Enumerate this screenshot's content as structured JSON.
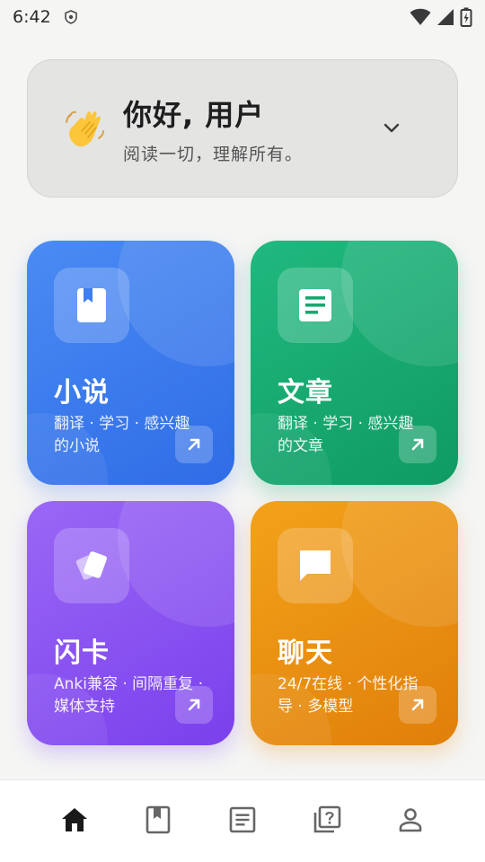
{
  "status_bar": {
    "time": "6:42"
  },
  "greeting": {
    "title": "你好, 用户",
    "subtitle": "阅读一切，理解所有。",
    "wave_icon": "waving-hand-icon",
    "expand_icon": "chevron-down-icon"
  },
  "cards": [
    {
      "title": "小说",
      "desc": "翻译 · 学习 · 感兴趣的小说",
      "icon": "book-icon",
      "color": "#3b7bee"
    },
    {
      "title": "文章",
      "desc": "翻译 · 学习 · 感兴趣的文章",
      "icon": "article-icon",
      "color": "#17a86f"
    },
    {
      "title": "闪卡",
      "desc": "Anki兼容 · 间隔重复 · 媒体支持",
      "icon": "cards-icon",
      "color": "#8a52f2"
    },
    {
      "title": "聊天",
      "desc": "24/7在线 · 个性化指导 · 多模型",
      "icon": "chat-icon",
      "color": "#ea9012"
    }
  ],
  "nav": {
    "items": [
      "home-icon",
      "bookmark-book-icon",
      "article-icon",
      "quiz-icon",
      "profile-icon"
    ],
    "active_index": 0
  }
}
